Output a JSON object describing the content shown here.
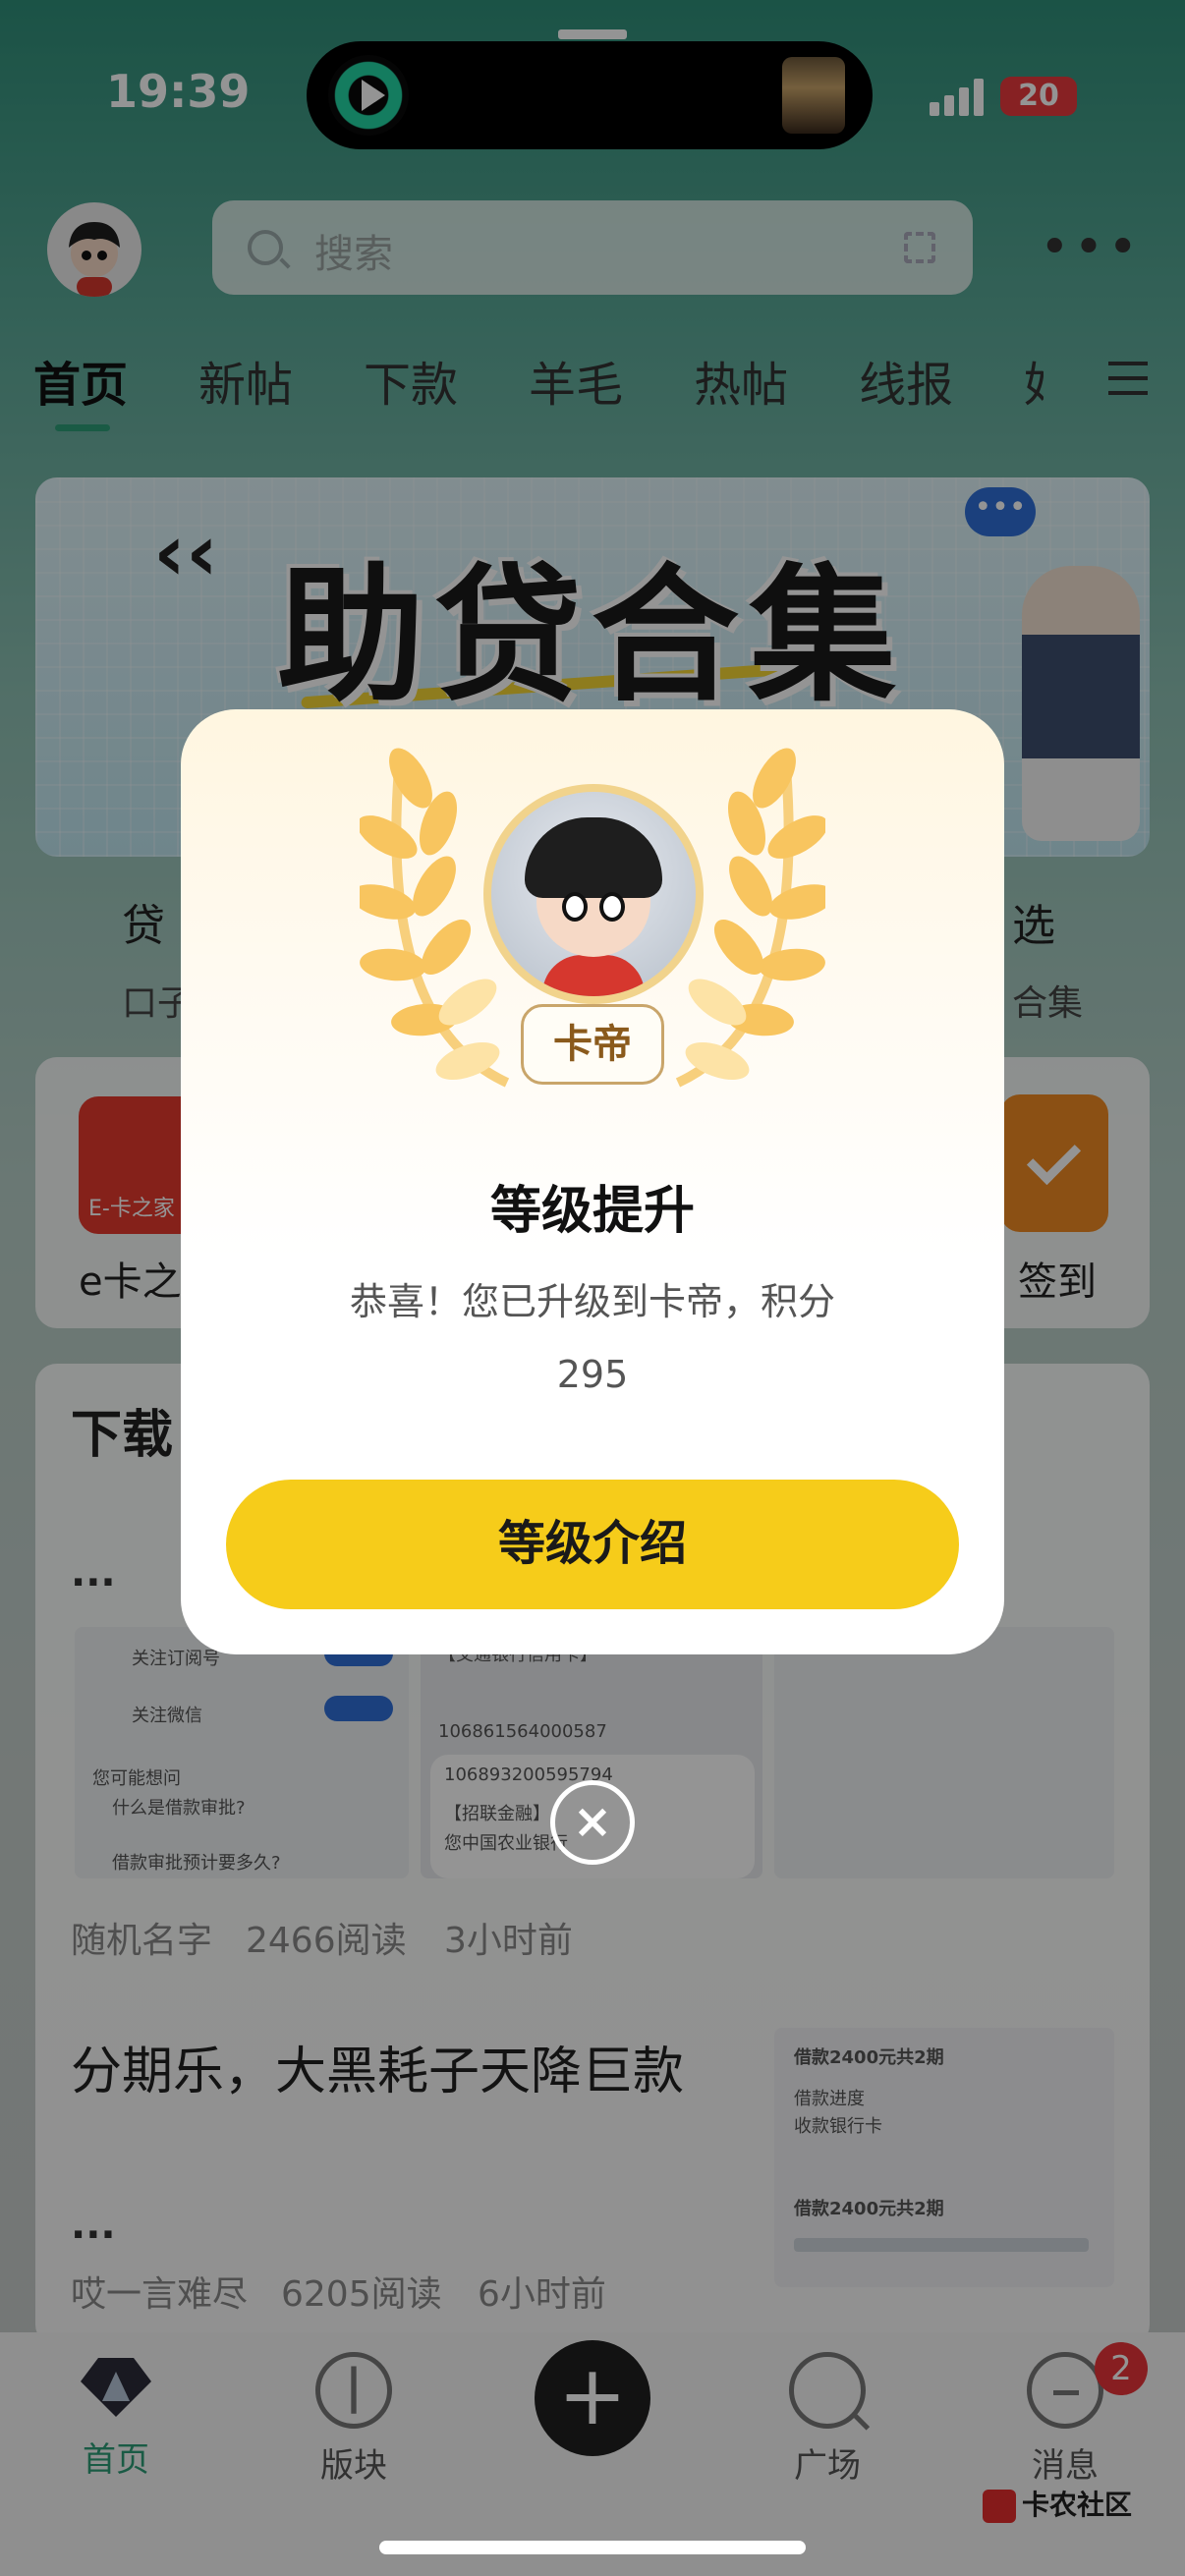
{
  "status_bar": {
    "time": "19:39",
    "battery": "20"
  },
  "header": {
    "search_placeholder": "搜索"
  },
  "tabs": [
    "首页",
    "新帖",
    "下款",
    "羊毛",
    "热帖",
    "线报",
    "好"
  ],
  "banner": {
    "title": "助贷合集"
  },
  "quick_links": {
    "left_label": "贷",
    "left_sub": "口子",
    "right_label": "选",
    "right_sub": "合集"
  },
  "icons_row": {
    "ecard_tile_text": "E-卡之家",
    "ecard_label": "e卡之",
    "sign_label": "签到"
  },
  "feed": {
    "section_title": "下载",
    "posts": [
      {
        "ellipsis": "...",
        "author": "随机名字",
        "reads": "2466阅读",
        "time": "3小时前",
        "thumb_texts": [
          "关注订阅号",
          "关注微信",
          "您可能想问",
          "什么是借款审批?",
          "借款审批预计要多久?",
          "【交通银行信用卡】",
          "106861564000587",
          "106893200595794",
          "【招联金融】",
          "您中国农业银行"
        ]
      },
      {
        "title": "分期乐，大黑耗子天降巨款",
        "ellipsis": "...",
        "author": "哎一言难尽",
        "reads": "6205阅读",
        "time": "6小时前",
        "thumb_texts": [
          "借款2400元共2期",
          "借款进度",
          "收款银行卡",
          "借款2400元共2期"
        ]
      }
    ]
  },
  "bottom_nav": {
    "items": [
      "首页",
      "版块",
      "广场",
      "消息"
    ],
    "plus": "+",
    "message_badge": "2"
  },
  "watermark": "卡农社区",
  "modal": {
    "rank": "卡帝",
    "title": "等级提升",
    "message": "恭喜！您已升级到卡帝，积分295",
    "button": "等级介绍",
    "close": "×"
  },
  "colors": {
    "accent_green": "#2e9e78",
    "button_yellow": "#f6cc1a",
    "badge_red": "#e9353a"
  }
}
